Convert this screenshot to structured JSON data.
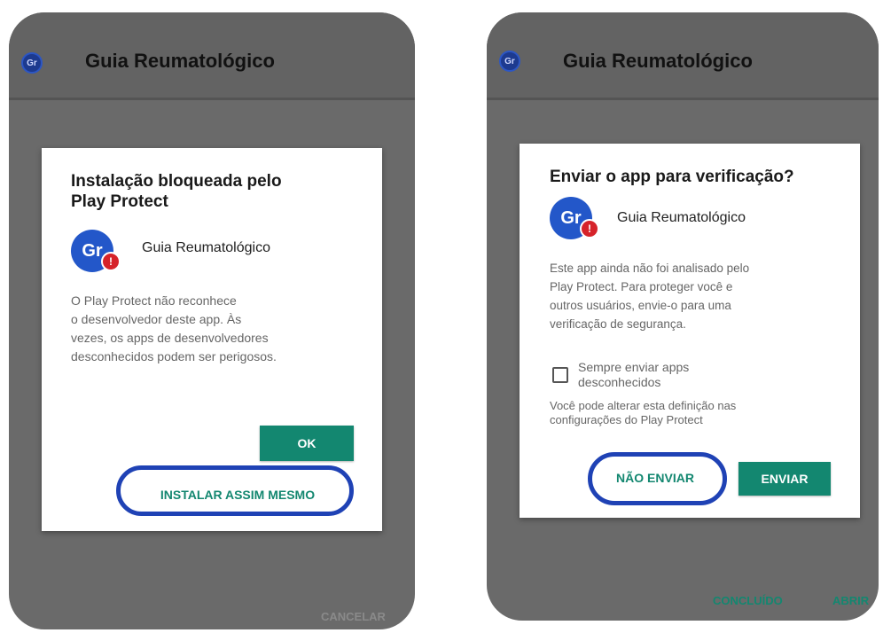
{
  "left_screen": {
    "app_icon_text": "Gr",
    "app_title": "Guia Reumatológico",
    "dialog": {
      "title_line1": "Instalação bloqueada pelo",
      "title_line2": "Play Protect",
      "app_name": "Guia Reumatológico",
      "body_lines": [
        "O Play Protect não reconhece",
        "o desenvolvedor deste app. Às",
        "vezes, os apps de desenvolvedores",
        "desconhecidos podem ser perigosos."
      ],
      "ok_label": "OK",
      "install_label": "INSTALAR ASSIM MESMO"
    },
    "cancel_label": "CANCELAR"
  },
  "right_screen": {
    "app_icon_text": "Gr",
    "app_title": "Guia Reumatológico",
    "dialog": {
      "title": "Enviar o app para verificação?",
      "app_name": "Guia Reumatológico",
      "body_lines": [
        "Este app ainda não foi analisado pelo",
        "Play Protect. Para proteger você e",
        "outros usuários, envie-o para uma",
        "verificação de segurança."
      ],
      "checkbox_line1": "Sempre enviar apps",
      "checkbox_line2": "desconhecidos",
      "note_line1": "Você pode alterar esta definição nas",
      "note_line2": "configurações do Play Protect",
      "dont_send_label": "NÃO ENVIAR",
      "send_label": "ENVIAR"
    },
    "done_label": "CONCLUÍDO",
    "open_label": "ABRIR"
  },
  "colors": {
    "accent_green": "#138770",
    "highlight_blue": "#1f42b5",
    "shield_red": "#d6232a",
    "icon_blue": "#2357c9"
  }
}
